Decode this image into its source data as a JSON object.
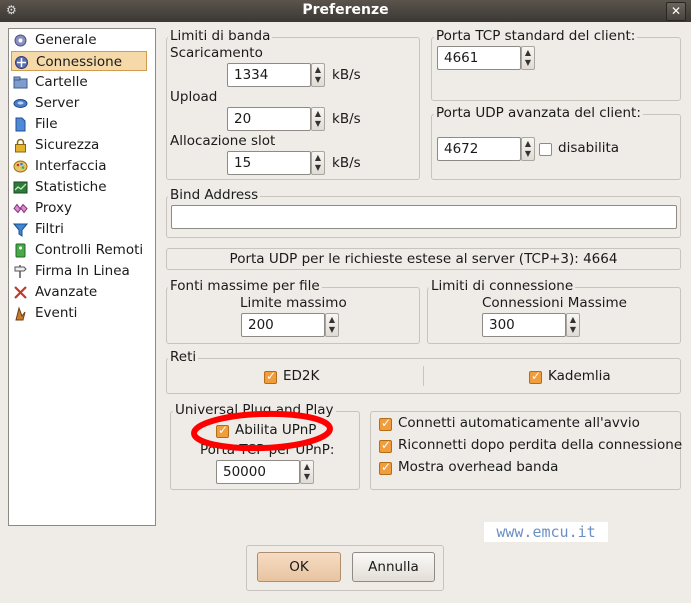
{
  "window": {
    "title": "Preferenze"
  },
  "sidebar": {
    "items": [
      {
        "label": "Generale",
        "icon": "gear-icon",
        "color": "#6a6fa3"
      },
      {
        "label": "Connessione",
        "icon": "connection-icon",
        "color": "#4c5f9a",
        "selected": true
      },
      {
        "label": "Cartelle",
        "icon": "folder-icon",
        "color": "#5b7bb2"
      },
      {
        "label": "Server",
        "icon": "server-icon",
        "color": "#3f6bb0"
      },
      {
        "label": "File",
        "icon": "file-icon",
        "color": "#3a78c9"
      },
      {
        "label": "Sicurezza",
        "icon": "lock-icon",
        "color": "#d9a322"
      },
      {
        "label": "Interfaccia",
        "icon": "palette-icon",
        "color": "#c08a2e"
      },
      {
        "label": "Statistiche",
        "icon": "chart-icon",
        "color": "#2d7a3a"
      },
      {
        "label": "Proxy",
        "icon": "proxy-icon",
        "color": "#b04aa0"
      },
      {
        "label": "Filtri",
        "icon": "filter-icon",
        "color": "#2f72c3"
      },
      {
        "label": "Controlli Remoti",
        "icon": "remote-icon",
        "color": "#3d9a3d"
      },
      {
        "label": "Firma In Linea",
        "icon": "signpost-icon",
        "color": "#777"
      },
      {
        "label": "Avanzate",
        "icon": "tools-icon",
        "color": "#c0392b"
      },
      {
        "label": "Eventi",
        "icon": "events-icon",
        "color": "#b5651d"
      }
    ]
  },
  "bandwidth": {
    "title": "Limiti di banda",
    "download_label": "Scaricamento",
    "download_value": "1334",
    "download_unit": "kB/s",
    "upload_label": "Upload",
    "upload_value": "20",
    "upload_unit": "kB/s",
    "slot_label": "Allocazione slot",
    "slot_value": "15",
    "slot_unit": "kB/s"
  },
  "tcp_port": {
    "title": "Porta TCP standard del client:",
    "value": "4661"
  },
  "udp_port": {
    "title": "Porta UDP avanzata del client:",
    "value": "4672",
    "disable_label": "disabilita",
    "disable_checked": false
  },
  "bind_address": {
    "title": "Bind Address",
    "value": ""
  },
  "udp_info": {
    "text": "Porta UDP per le richieste estese al server (TCP+3): 4664"
  },
  "max_sources": {
    "title": "Fonti massime per file",
    "label": "Limite massimo",
    "value": "200"
  },
  "conn_limits": {
    "title": "Limiti di connessione",
    "label": "Connessioni Massime",
    "value": "300"
  },
  "networks": {
    "title": "Reti",
    "ed2k_label": "ED2K",
    "ed2k_checked": true,
    "kad_label": "Kademlia",
    "kad_checked": true
  },
  "upnp": {
    "title": "Universal Plug and Play",
    "enable_label": "Abilita UPnP",
    "enable_checked": true,
    "port_label": "Porta TCP per UPnP:",
    "port_value": "50000"
  },
  "options": {
    "items": [
      {
        "label": "Connetti automaticamente all'avvio",
        "checked": true
      },
      {
        "label": "Riconnetti dopo perdita della connessione",
        "checked": true
      },
      {
        "label": "Mostra overhead banda",
        "checked": true
      }
    ]
  },
  "buttons": {
    "ok": "OK",
    "cancel": "Annulla"
  },
  "watermark": {
    "text": "www.emcu.it"
  },
  "colors": {
    "accent": "#f29d3b",
    "selection": "#f5d9a9",
    "annotation": "#ff0000"
  }
}
